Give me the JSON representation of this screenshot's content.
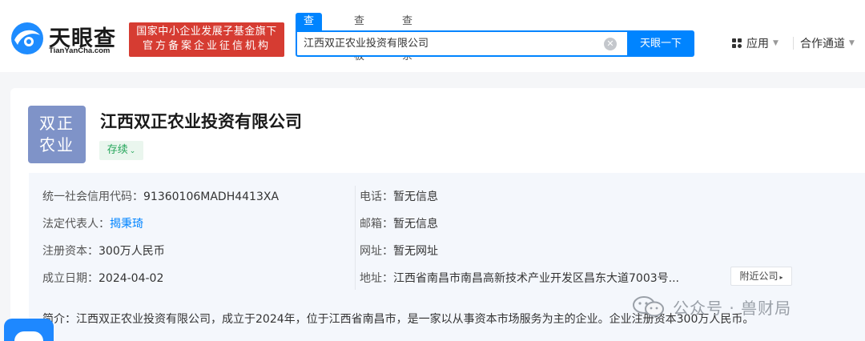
{
  "header": {
    "logo_cn": "天眼查",
    "logo_en": "TianYanCha.com",
    "badge_line1": "国家中小企业发展子基金旗下",
    "badge_line2": "官方备案企业征信机构",
    "tabs": [
      {
        "label": "查公司",
        "active": true
      },
      {
        "label": "查老板",
        "active": false
      },
      {
        "label": "查关系",
        "active": false
      }
    ],
    "search_value": "江西双正农业投资有限公司",
    "search_button": "天眼一下",
    "nav_apps": "应用",
    "nav_channel": "合作通道"
  },
  "company": {
    "logo_text_line1": "双正",
    "logo_text_line2": "农业",
    "name": "江西双正农业投资有限公司",
    "status": "存续",
    "left": [
      {
        "label": "统一社会信用代码：",
        "value": "91360106MADH4413XA"
      },
      {
        "label": "法定代表人：",
        "value": "揭秉琦"
      },
      {
        "label": "注册资本：",
        "value": "300万人民币"
      },
      {
        "label": "成立日期：",
        "value": "2024-04-02"
      }
    ],
    "right": [
      {
        "label": "电话：",
        "value": "暂无信息"
      },
      {
        "label": "邮箱：",
        "value": "暂无信息"
      },
      {
        "label": "网址：",
        "value": "暂无网址"
      },
      {
        "label": "地址：",
        "value": "江西省南昌市南昌高新技术产业开发区昌东大道7003号..."
      }
    ],
    "nearby_button": "附近公司",
    "intro_label": "简介：",
    "intro_text": "江西双正农业投资有限公司，成立于2024年，位于江西省南昌市，是一家以从事资本市场服务为主的企业。企业注册资本300万人民币。"
  },
  "watermark": "公众号 · 兽财局",
  "colors": {
    "brand_blue": "#0084ff",
    "badge_red": "#d63c32",
    "status_green": "#26a65b",
    "logo_purple": "#7f93c8"
  }
}
